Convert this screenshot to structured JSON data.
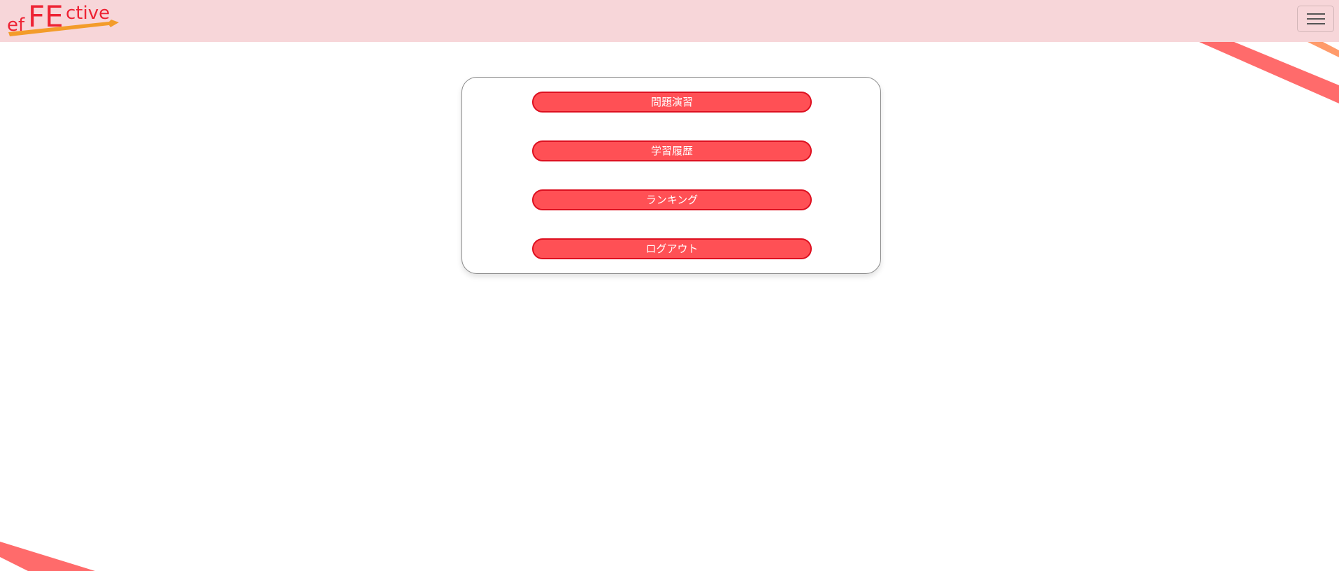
{
  "app": {
    "logo_text": "efFEctive"
  },
  "navbar": {
    "menu_toggle": "hamburger-menu-icon"
  },
  "menu": {
    "items": [
      {
        "label": "問題演習"
      },
      {
        "label": "学習履歴"
      },
      {
        "label": "ランキング"
      },
      {
        "label": "ログアウト"
      }
    ]
  },
  "colors": {
    "navbar_bg": "#f7d6d9",
    "button_bg": "#ff5055",
    "button_border": "#dd1020",
    "stripe": "#ff6b6b",
    "stripe_accent": "#ff9b6b",
    "logo_red": "#ee2233",
    "logo_arrow": "#f39c2a"
  }
}
